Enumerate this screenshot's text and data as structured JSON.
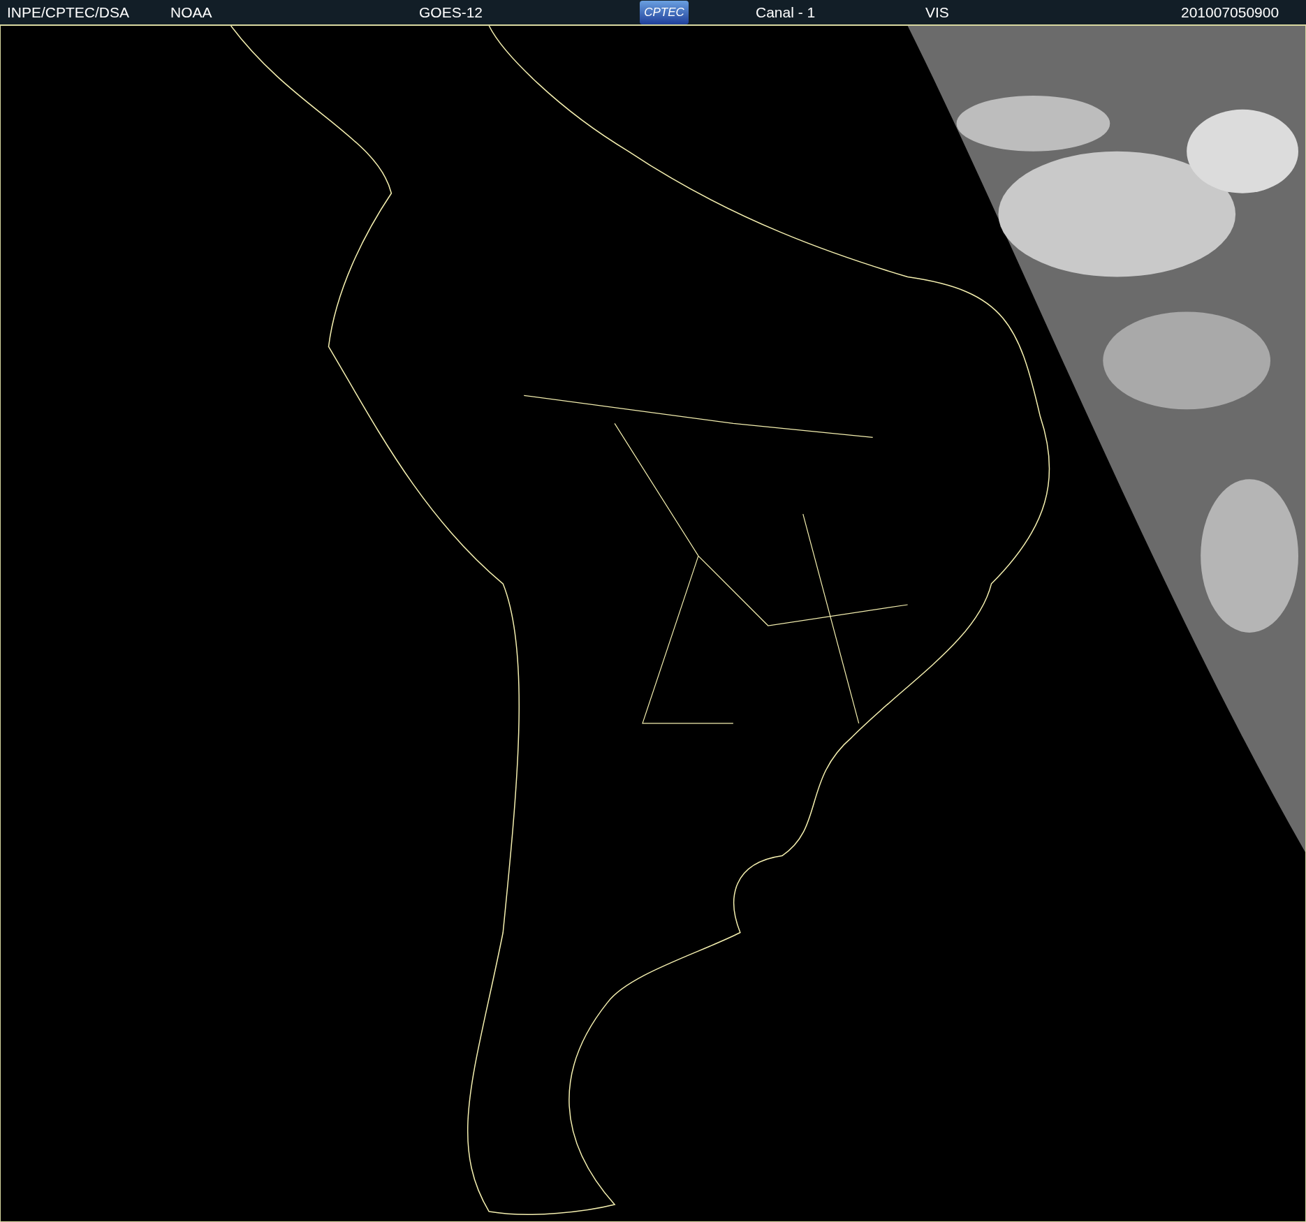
{
  "header": {
    "source": "INPE/CPTEC/DSA",
    "agency": "NOAA",
    "satellite": "GOES-12",
    "logo": "CPTEC",
    "channel": "Canal - 1",
    "band": "VIS",
    "timestamp": "201007050900"
  }
}
